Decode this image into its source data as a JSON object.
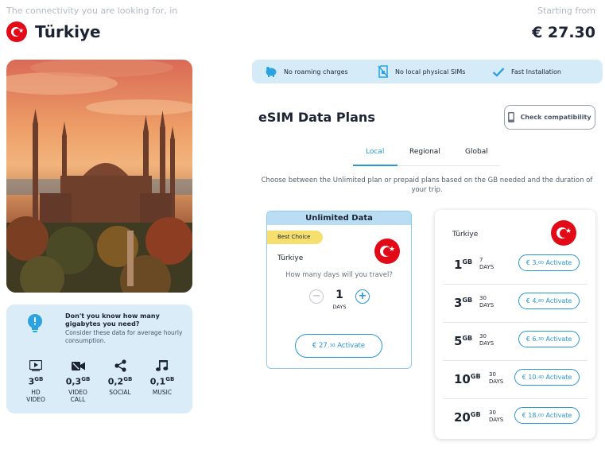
{
  "header": {
    "tagline": "The connectivity you are looking for, in",
    "country": "Türkiye",
    "starting_label": "Starting from",
    "starting_price": "€ 27.30"
  },
  "info": {
    "question": "Don't you know how many gigabytes you need?",
    "subtext": "Consider these data for average hourly consumption.",
    "usages": [
      {
        "icon": "video-icon",
        "value": "3",
        "unit": "GB",
        "label": "HD\nVIDEO"
      },
      {
        "icon": "video-call-icon",
        "value": "0,3",
        "unit": "GB",
        "label": "VIDEO\nCALL"
      },
      {
        "icon": "share-icon",
        "value": "0,2",
        "unit": "GB",
        "label": "SOCIAL"
      },
      {
        "icon": "music-icon",
        "value": "0,1",
        "unit": "GB",
        "label": "MUSIC"
      }
    ]
  },
  "features": [
    {
      "icon": "piggy-bank-icon",
      "label": "No roaming charges"
    },
    {
      "icon": "no-sim-icon",
      "label": "No local physical SIMs"
    },
    {
      "icon": "checkmark-icon",
      "label": "Fast Installation"
    }
  ],
  "plans_section": {
    "title": "eSIM Data Plans",
    "check_button": "Check compatibility",
    "tabs": [
      "Local",
      "Regional",
      "Global"
    ],
    "active_tab": "Local",
    "description": "Choose between the Unlimited plan or prepaid plans based on the GB needed and the duration of your trip."
  },
  "unlimited": {
    "header": "Unlimited Data",
    "badge": "Best Choice",
    "country": "Türkiye",
    "question": "How many days will you travel?",
    "days": "1",
    "days_unit": "DAYS",
    "activate_price": "€ 27.",
    "activate_cents": "30",
    "activate_label": "Activate"
  },
  "prepaid": {
    "country": "Türkiye",
    "plans": [
      {
        "gb": "1",
        "unit": "GB",
        "days": "7",
        "days_unit": "DAYS",
        "price": "€ 3.",
        "cents": "00",
        "label": "Activate"
      },
      {
        "gb": "3",
        "unit": "GB",
        "days": "30",
        "days_unit": "DAYS",
        "price": "€ 4.",
        "cents": "80",
        "label": "Activate"
      },
      {
        "gb": "5",
        "unit": "GB",
        "days": "30",
        "days_unit": "DAYS",
        "price": "€ 6.",
        "cents": "30",
        "label": "Activate"
      },
      {
        "gb": "10",
        "unit": "GB",
        "days": "30",
        "days_unit": "DAYS",
        "price": "€ 10.",
        "cents": "40",
        "label": "Activate"
      },
      {
        "gb": "20",
        "unit": "GB",
        "days": "30",
        "days_unit": "DAYS",
        "price": "€ 18.",
        "cents": "00",
        "label": "Activate"
      }
    ]
  },
  "colors": {
    "accent": "#2796d4",
    "flag_red": "#e30a17",
    "light_blue": "#d6ebf8",
    "badge_yellow": "#f5df6e"
  }
}
